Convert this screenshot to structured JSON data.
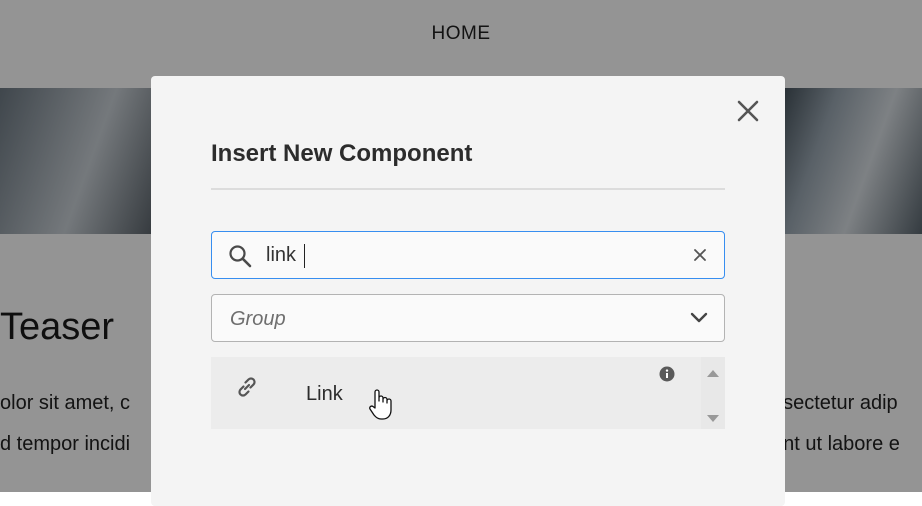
{
  "page": {
    "nav": {
      "home": "HOME"
    },
    "teaser": {
      "title": "Teaser",
      "line1_left": "olor sit amet, c",
      "line1_right": "nsectetur adip",
      "line2_left": "d tempor incidi",
      "line2_right": "unt ut labore e"
    }
  },
  "dialog": {
    "title": "Insert New Component",
    "search": {
      "value": "link"
    },
    "group_select": {
      "value": "Group"
    },
    "results": [
      {
        "label": "Link",
        "icon": "link-icon"
      }
    ]
  },
  "colors": {
    "overlay": "rgba(0,0,0,0.42)",
    "dialog_bg": "#f4f4f4",
    "focus_border": "#378ef0"
  }
}
